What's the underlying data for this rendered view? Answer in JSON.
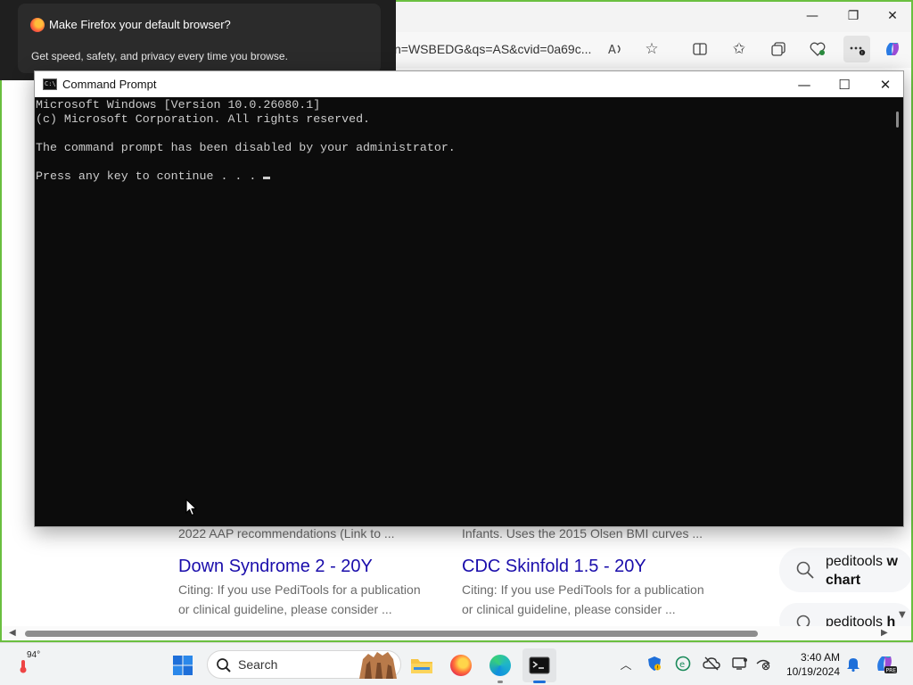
{
  "edge": {
    "url_text": "n=WSBEDG&qs=AS&cvid=0a69c...",
    "controls": {
      "minimize": "—",
      "maximize": "❐",
      "close": "✕"
    },
    "results": {
      "left_snippet": "2022 AAP recommendations (Link to ...",
      "right_snippet": "Infants. Uses the 2015 Olsen BMI curves ...",
      "left_title": "Down Syndrome 2 - 20Y",
      "right_title": "CDC Skinfold 1.5 - 20Y",
      "left_text_1": "Citing: If you use PediTools for a publication",
      "left_text_2": "or clinical guideline, please consider ...",
      "right_text_1": "Citing: If you use PediTools for a publication",
      "right_text_2": "or clinical guideline, please consider ...",
      "related_1a": "peditools",
      "related_1b": "w",
      "related_1c": "chart",
      "related_2a": "peditools",
      "related_2b": "h"
    }
  },
  "firefox_notification": {
    "title": "Make Firefox your default browser?",
    "body": "Get speed, safety, and privacy every time you browse."
  },
  "cmd": {
    "title": "Command Prompt",
    "lines": [
      "Microsoft Windows [Version 10.0.26080.1]",
      "(c) Microsoft Corporation. All rights reserved.",
      "",
      "The command prompt has been disabled by your administrator.",
      "",
      "Press any key to continue . . . "
    ],
    "controls": {
      "minimize": "—",
      "maximize": "☐",
      "close": "✕"
    }
  },
  "taskbar": {
    "weather_temp": "94°",
    "search_label": "Search",
    "clock_time": "3:40 AM",
    "clock_date": "10/19/2024"
  },
  "colors": {
    "desktop_accent": "#6abf3f",
    "console_bg": "#0c0c0c",
    "console_text": "#cccccc",
    "link_blue": "#1a0dab"
  }
}
